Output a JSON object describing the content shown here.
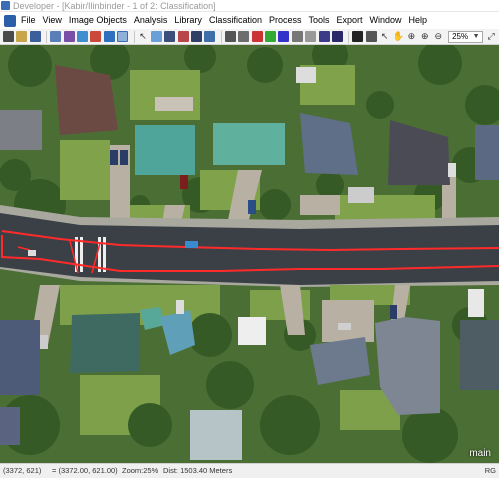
{
  "window": {
    "title": "Developer - [Kabir/Ilinbinder - 1 of 2: Classification]"
  },
  "menu": {
    "items": [
      "File",
      "View",
      "Image Objects",
      "Analysis",
      "Library",
      "Classification",
      "Process",
      "Tools",
      "Export",
      "Window",
      "Help"
    ]
  },
  "toolbar": {
    "zoom_value": "25%",
    "buttons": [
      "grid-icon",
      "open-icon",
      "save-icon",
      "image-icon",
      "project-icon",
      "layers-icon",
      "classify-icon",
      "sample-icon",
      "select-icon",
      "cursor-icon",
      "mosaic-icon",
      "mixed-view-icon",
      "outline-icon",
      "transparency-icon",
      "pixel-view-icon",
      "object-view-icon",
      "class-view-icon",
      "layer-red-icon",
      "layer-green-icon",
      "layer-blue-icon",
      "single-layer-icon",
      "three-layer-icon",
      "image-layer-icon",
      "palette-icon",
      "brush-icon",
      "bookmark-icon",
      "pointer-icon",
      "pan-icon",
      "zoom-area-icon",
      "zoom-in-icon",
      "zoom-out-icon",
      "zoom-fit-icon"
    ]
  },
  "canvas": {
    "view_label": "main"
  },
  "status": {
    "pixel_coords": "(3372, 621)",
    "map_coords": "= (3372.00, 621.00)",
    "zoom": "Zoom:25%",
    "distance": "Dist: 1503.40 Meters",
    "right_code": "RG"
  },
  "colors": {
    "road": "#3b4047",
    "classification_outline": "#ff2b2b",
    "vegetation": "#3f6b2e",
    "lawn": "#7ea04a",
    "roof_teal": "#4fa59a",
    "roof_grey": "#5f6876"
  }
}
